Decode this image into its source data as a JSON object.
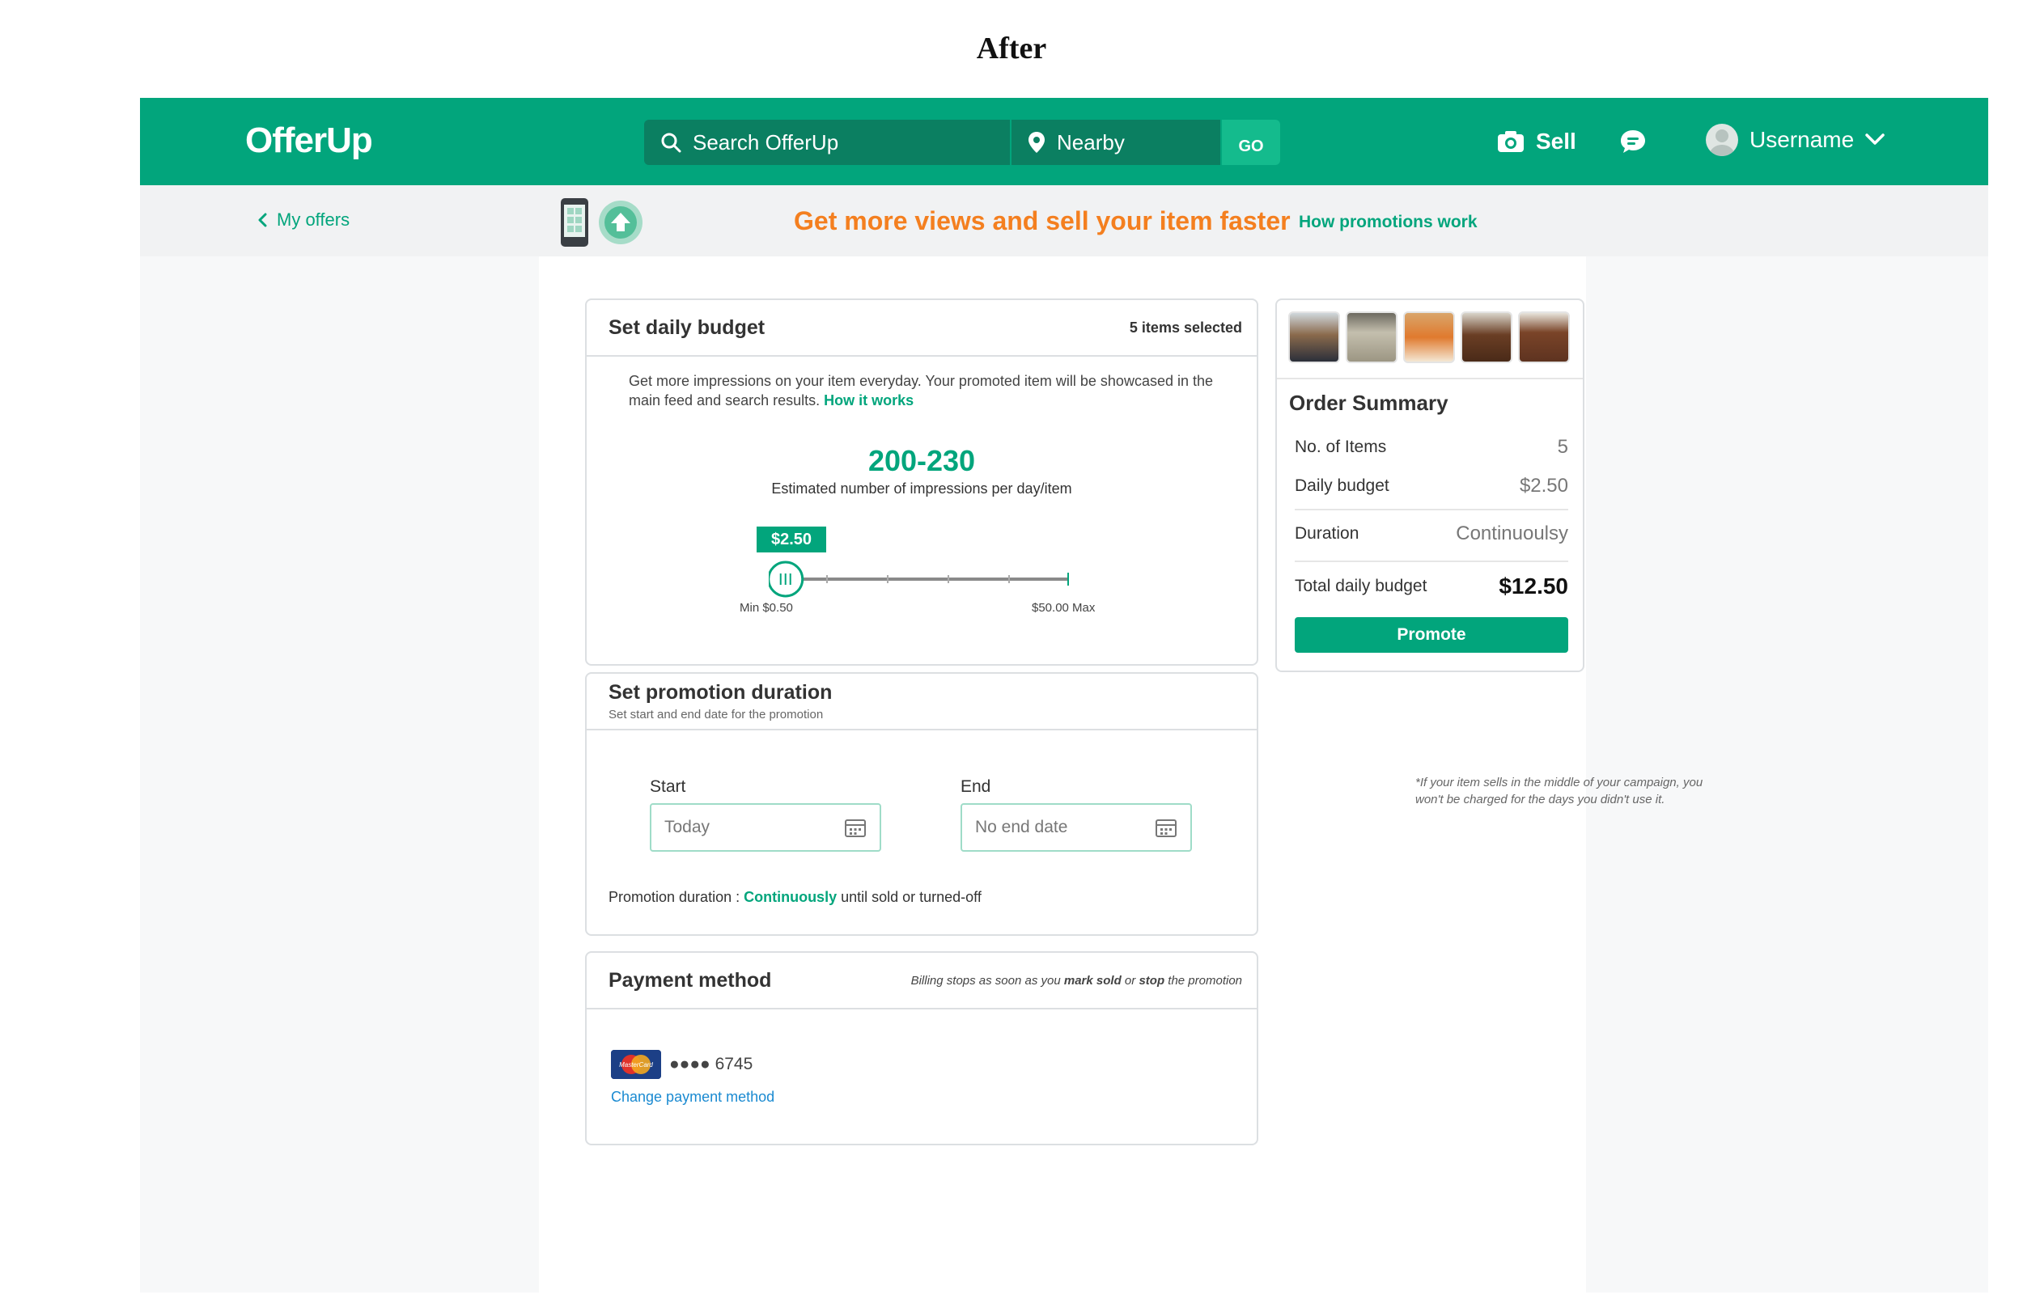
{
  "caption": "After",
  "header": {
    "logo": "OfferUp",
    "search_placeholder": "Search OfferUp",
    "location": "Nearby",
    "go_label": "GO",
    "sell_label": "Sell",
    "username": "Username"
  },
  "subbar": {
    "back_label": "My offers",
    "promo_text": "Get more views and sell your item faster",
    "promo_link": "How promotions work"
  },
  "budget": {
    "title": "Set daily budget",
    "items_selected": "5 items selected",
    "description": "Get more impressions on your item everyday. Your promoted item will be showcased in the main feed and search results.",
    "how_link": "How it works",
    "impressions_range": "200-230",
    "impressions_caption": "Estimated number of impressions per day/item",
    "price_tag": "$2.50",
    "min_label": "Min $0.50",
    "max_label": "$50.00 Max",
    "slider_fraction": 0.04
  },
  "duration": {
    "title": "Set promotion duration",
    "subtitle": "Set start and end date for the promotion",
    "start_label": "Start",
    "start_value": "Today",
    "end_label": "End",
    "end_value": "No end date",
    "line_prefix": "Promotion duration : ",
    "line_value": "Continuously",
    "line_suffix": " until sold or turned-off"
  },
  "payment": {
    "title": "Payment method",
    "note_prefix": "Billing stops as soon as you ",
    "note_b1": "mark sold",
    "note_mid": " or ",
    "note_b2": "stop",
    "note_suffix": " the promotion",
    "card_dots": "●●●● 6745",
    "card_brand": "MasterCard",
    "change_label": "Change payment method"
  },
  "summary": {
    "title": "Order Summary",
    "rows": [
      {
        "label": "No. of Items",
        "value": "5"
      },
      {
        "label": "Daily budget",
        "value": "$2.50"
      },
      {
        "label": "Duration",
        "value": "Continuoulsy"
      },
      {
        "label": "Total daily budget",
        "value": "$12.50"
      }
    ],
    "promote_label": "Promote",
    "footnote": "*If your item sells in the middle of your campaign, you won't be charged for the days you didn't use it."
  },
  "colors": {
    "brand": "#02a57c",
    "brand_dark": "#0b7f61",
    "promo_orange": "#f47f1f",
    "link_blue": "#1a8ad1"
  }
}
